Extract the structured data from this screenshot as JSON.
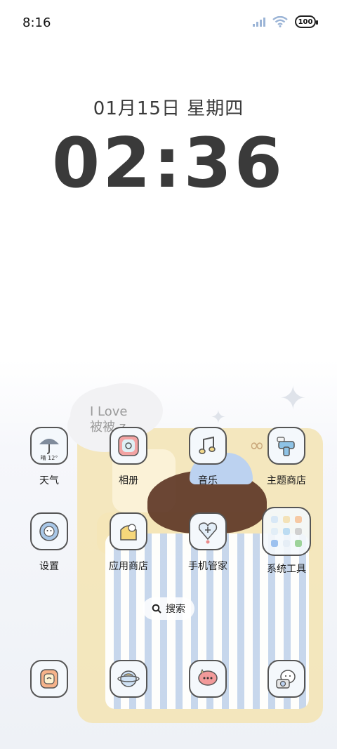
{
  "status_bar": {
    "time": "8:16",
    "battery": "100"
  },
  "clock": {
    "date": "01月15日 星期四",
    "time": "02:36"
  },
  "wallpaper": {
    "cloud_text_line1": "I Love",
    "cloud_text_line2": "被被 z"
  },
  "apps": [
    {
      "label": "天气",
      "icon": "weather-icon",
      "detail": "晴 12°"
    },
    {
      "label": "相册",
      "icon": "album-icon"
    },
    {
      "label": "音乐",
      "icon": "music-icon"
    },
    {
      "label": "主题商店",
      "icon": "theme-store-icon"
    },
    {
      "label": "设置",
      "icon": "settings-icon"
    },
    {
      "label": "应用商店",
      "icon": "app-store-icon"
    },
    {
      "label": "手机管家",
      "icon": "phone-manager-icon"
    },
    {
      "label": "系统工具",
      "icon": "folder-icon"
    }
  ],
  "search": {
    "label": "搜索"
  },
  "dock": [
    {
      "icon": "phone-icon"
    },
    {
      "icon": "browser-icon"
    },
    {
      "icon": "messages-icon"
    },
    {
      "icon": "camera-icon"
    }
  ],
  "colors": {
    "icon_border": "#555555",
    "icon_bg": "#f4f8fc",
    "bed_yellow": "#f3e4b3",
    "stripe_blue": "#c5d6ee"
  }
}
